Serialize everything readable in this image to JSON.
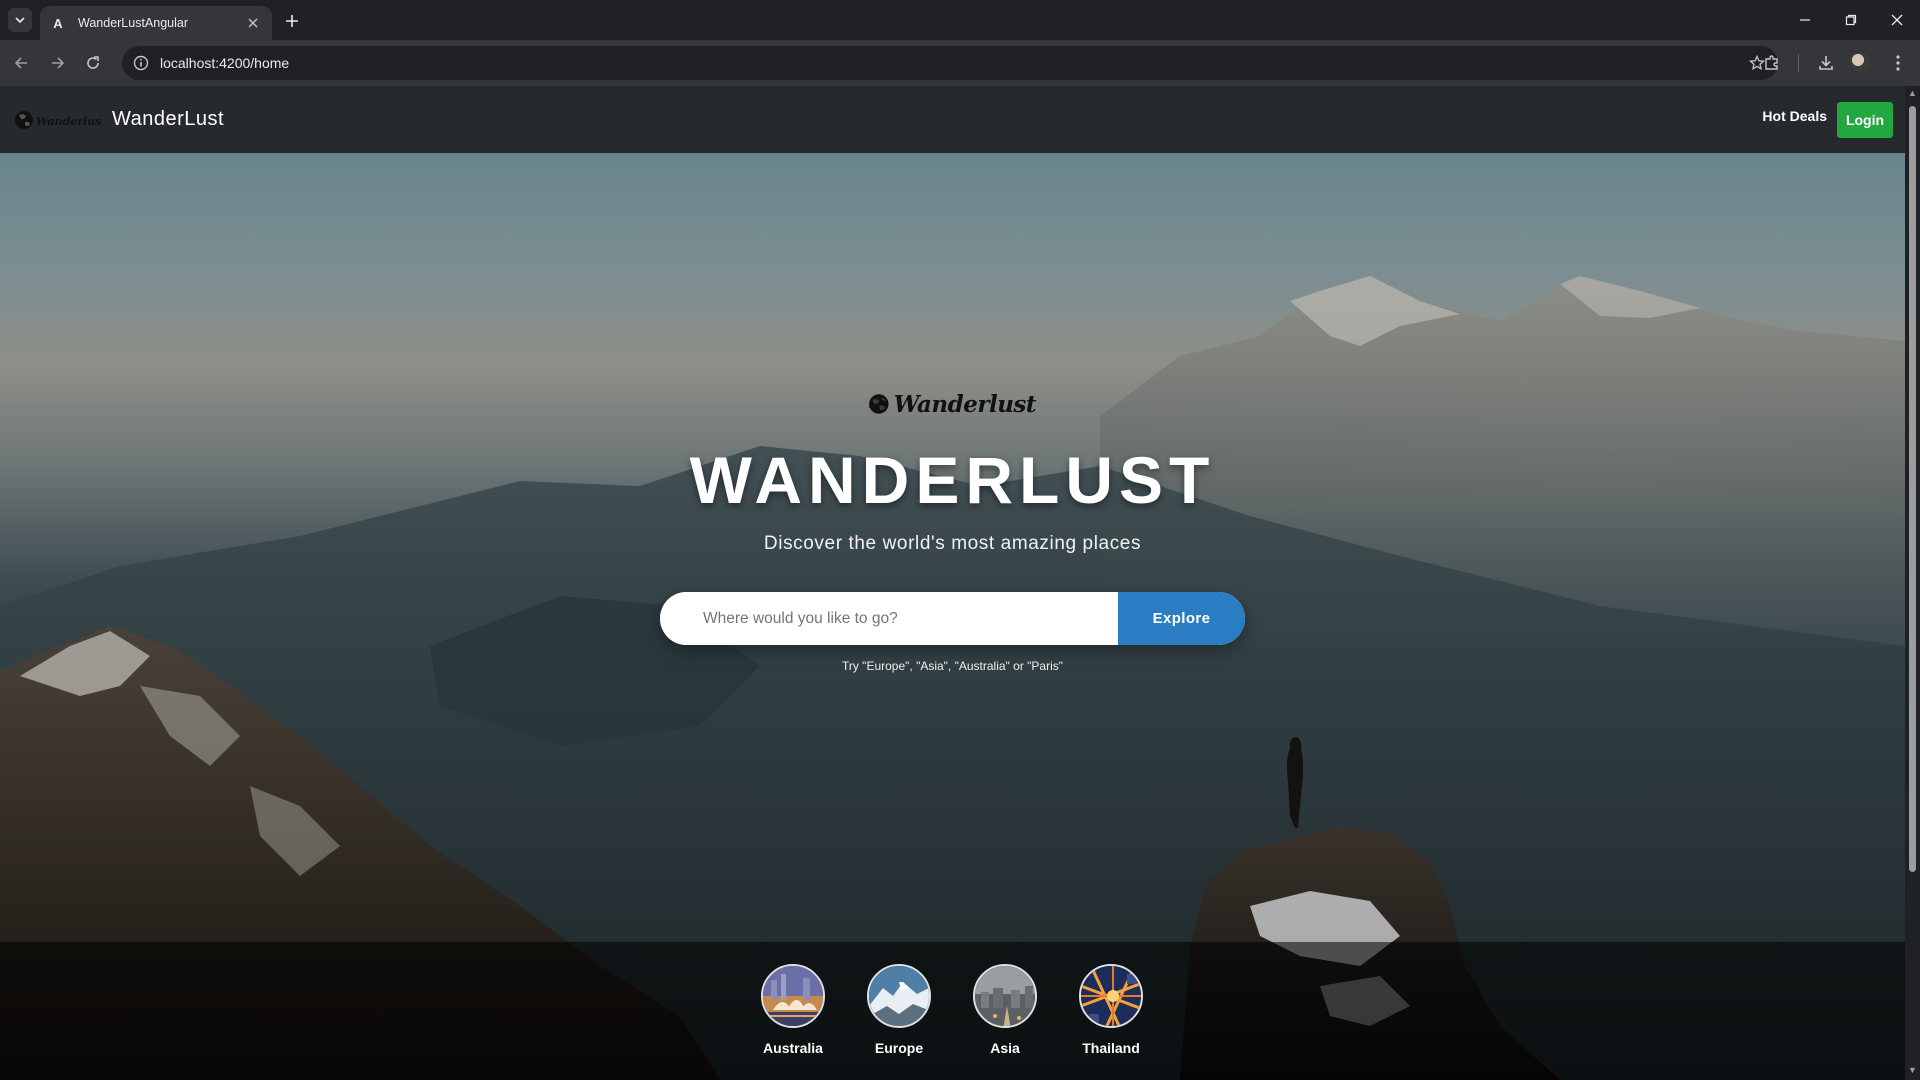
{
  "browser": {
    "tab_title": "WanderLustAngular",
    "tab_favicon": "A",
    "url": "localhost:4200/home"
  },
  "navbar": {
    "logo_text": "Wanderlust",
    "brand": "WanderLust",
    "hot_deals": "Hot Deals",
    "login": "Login",
    "login_color": "#22a83f"
  },
  "hero": {
    "logo_text": "Wanderlust",
    "title": "WANDERLUST",
    "subtitle": "Discover the world's most amazing places",
    "search_placeholder": "Where would you like to go?",
    "search_value": "",
    "explore_button": "Explore",
    "explore_color": "#2b7dc3",
    "hint": "Try \"Europe\", \"Asia\", \"Australia\" or \"Paris\""
  },
  "destinations": [
    {
      "label": "Australia",
      "icon": "sydney-opera-house-thumbnail"
    },
    {
      "label": "Europe",
      "icon": "alps-thumbnail"
    },
    {
      "label": "Asia",
      "icon": "asian-city-thumbnail"
    },
    {
      "label": "Thailand",
      "icon": "city-lights-thumbnail"
    }
  ]
}
